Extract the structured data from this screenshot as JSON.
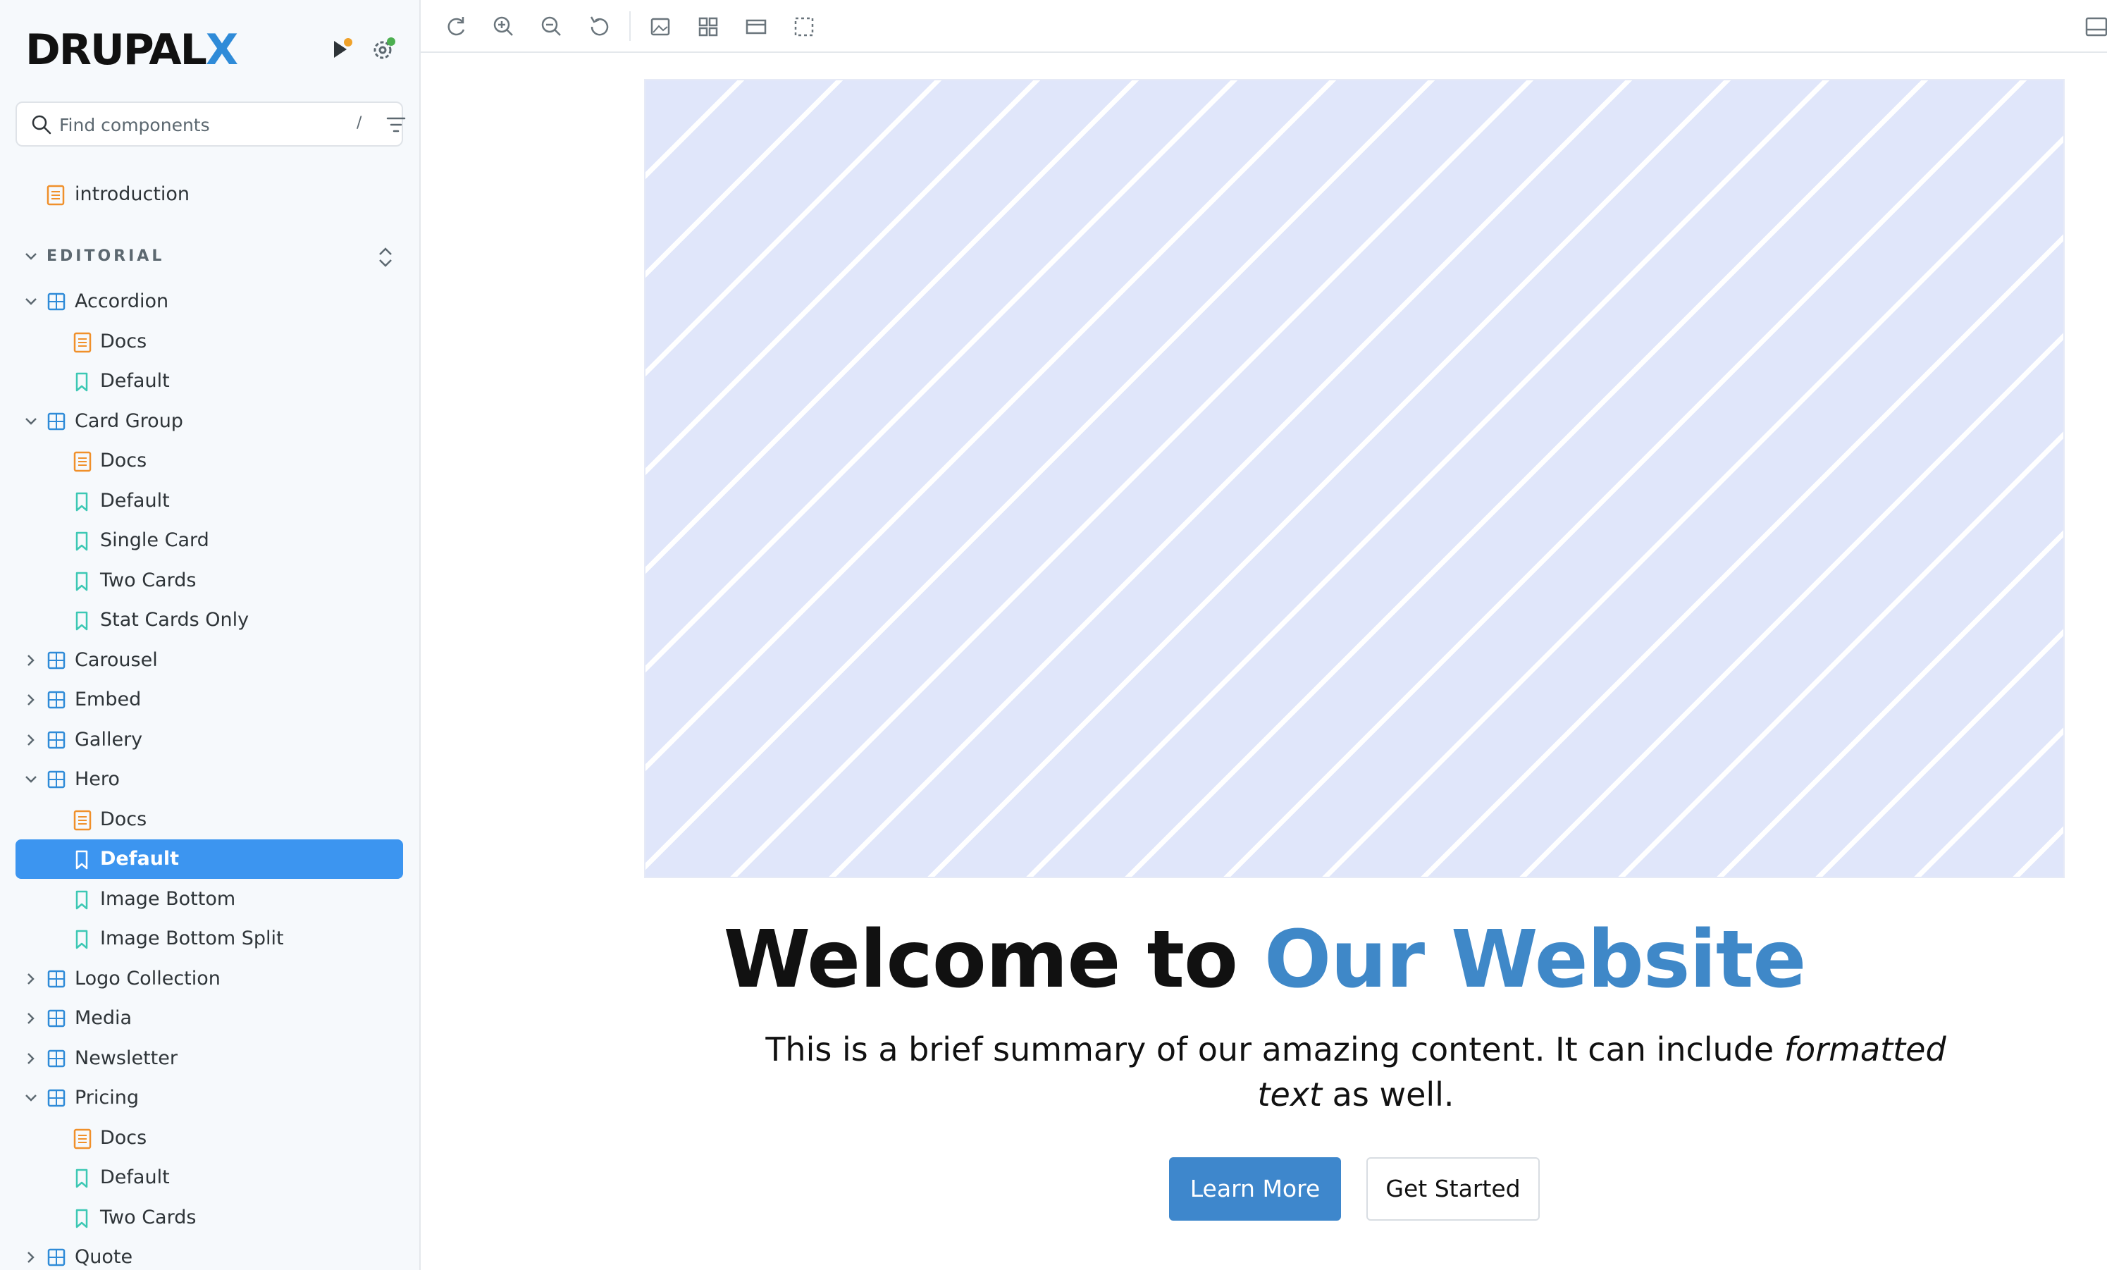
{
  "brand": {
    "name_main": "DRUPAL",
    "name_accent": "X"
  },
  "colors": {
    "brand_accent": "#2f8bd8",
    "selected_bg": "#3c95f0",
    "component_icon": "#2f8bd8",
    "docs_icon": "#f0902a",
    "story_icon": "#3cc8b4",
    "hero_accent": "#3f88c8"
  },
  "search": {
    "placeholder": "Find components",
    "shortcut": "/"
  },
  "sidebar": {
    "top_item": {
      "label": "introduction",
      "icon": "document-icon"
    },
    "section": {
      "label": "EDITORIAL"
    },
    "tree": [
      {
        "label": "Accordion",
        "kind": "component",
        "expanded": true
      },
      {
        "label": "Docs",
        "kind": "docs"
      },
      {
        "label": "Default",
        "kind": "story"
      },
      {
        "label": "Card Group",
        "kind": "component",
        "expanded": true
      },
      {
        "label": "Docs",
        "kind": "docs"
      },
      {
        "label": "Default",
        "kind": "story"
      },
      {
        "label": "Single Card",
        "kind": "story"
      },
      {
        "label": "Two Cards",
        "kind": "story"
      },
      {
        "label": "Stat Cards Only",
        "kind": "story"
      },
      {
        "label": "Carousel",
        "kind": "component",
        "expanded": false
      },
      {
        "label": "Embed",
        "kind": "component",
        "expanded": false
      },
      {
        "label": "Gallery",
        "kind": "component",
        "expanded": false
      },
      {
        "label": "Hero",
        "kind": "component",
        "expanded": true
      },
      {
        "label": "Docs",
        "kind": "docs"
      },
      {
        "label": "Default",
        "kind": "story",
        "selected": true
      },
      {
        "label": "Image Bottom",
        "kind": "story"
      },
      {
        "label": "Image Bottom Split",
        "kind": "story"
      },
      {
        "label": "Logo Collection",
        "kind": "component",
        "expanded": false
      },
      {
        "label": "Media",
        "kind": "component",
        "expanded": false
      },
      {
        "label": "Newsletter",
        "kind": "component",
        "expanded": false
      },
      {
        "label": "Pricing",
        "kind": "component",
        "expanded": true
      },
      {
        "label": "Docs",
        "kind": "docs"
      },
      {
        "label": "Default",
        "kind": "story"
      },
      {
        "label": "Two Cards",
        "kind": "story"
      },
      {
        "label": "Quote",
        "kind": "component",
        "expanded": false
      }
    ]
  },
  "toolbar": {
    "tools": [
      "reload-icon",
      "zoom-in-icon",
      "zoom-out-icon",
      "reset-zoom-icon",
      "background-icon",
      "grid-icon",
      "viewport-icon",
      "outline-icon"
    ]
  },
  "hero": {
    "title_plain": "Welcome to ",
    "title_accent": "Our Website",
    "summary_before": "This is a brief summary of our amazing content. It can include ",
    "summary_emphasis": "formatted text",
    "summary_after": " as well.",
    "primary_button": "Learn More",
    "secondary_button": "Get Started"
  }
}
